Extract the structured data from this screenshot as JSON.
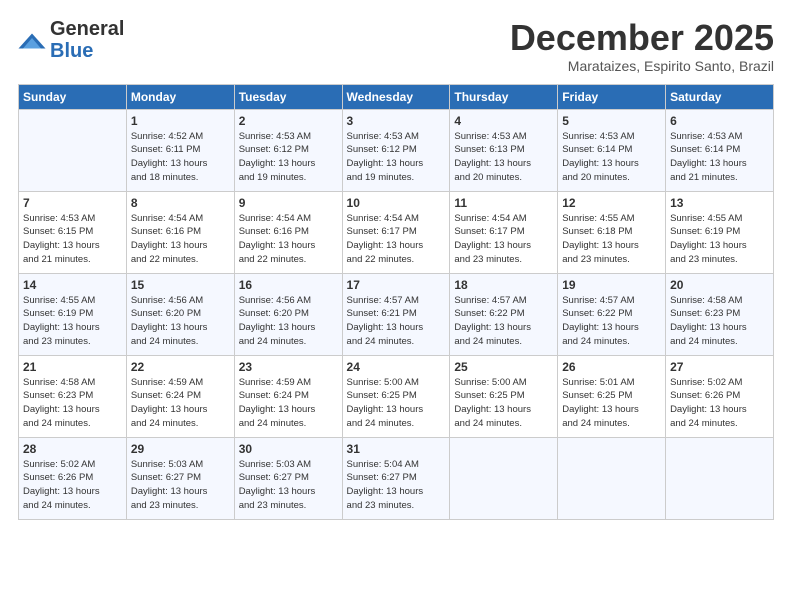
{
  "logo": {
    "line1": "General",
    "line2": "Blue"
  },
  "title": "December 2025",
  "subtitle": "Marataizes, Espirito Santo, Brazil",
  "header_days": [
    "Sunday",
    "Monday",
    "Tuesday",
    "Wednesday",
    "Thursday",
    "Friday",
    "Saturday"
  ],
  "weeks": [
    [
      {
        "day": "",
        "content": ""
      },
      {
        "day": "1",
        "content": "Sunrise: 4:52 AM\nSunset: 6:11 PM\nDaylight: 13 hours\nand 18 minutes."
      },
      {
        "day": "2",
        "content": "Sunrise: 4:53 AM\nSunset: 6:12 PM\nDaylight: 13 hours\nand 19 minutes."
      },
      {
        "day": "3",
        "content": "Sunrise: 4:53 AM\nSunset: 6:12 PM\nDaylight: 13 hours\nand 19 minutes."
      },
      {
        "day": "4",
        "content": "Sunrise: 4:53 AM\nSunset: 6:13 PM\nDaylight: 13 hours\nand 20 minutes."
      },
      {
        "day": "5",
        "content": "Sunrise: 4:53 AM\nSunset: 6:14 PM\nDaylight: 13 hours\nand 20 minutes."
      },
      {
        "day": "6",
        "content": "Sunrise: 4:53 AM\nSunset: 6:14 PM\nDaylight: 13 hours\nand 21 minutes."
      }
    ],
    [
      {
        "day": "7",
        "content": "Sunrise: 4:53 AM\nSunset: 6:15 PM\nDaylight: 13 hours\nand 21 minutes."
      },
      {
        "day": "8",
        "content": "Sunrise: 4:54 AM\nSunset: 6:16 PM\nDaylight: 13 hours\nand 22 minutes."
      },
      {
        "day": "9",
        "content": "Sunrise: 4:54 AM\nSunset: 6:16 PM\nDaylight: 13 hours\nand 22 minutes."
      },
      {
        "day": "10",
        "content": "Sunrise: 4:54 AM\nSunset: 6:17 PM\nDaylight: 13 hours\nand 22 minutes."
      },
      {
        "day": "11",
        "content": "Sunrise: 4:54 AM\nSunset: 6:17 PM\nDaylight: 13 hours\nand 23 minutes."
      },
      {
        "day": "12",
        "content": "Sunrise: 4:55 AM\nSunset: 6:18 PM\nDaylight: 13 hours\nand 23 minutes."
      },
      {
        "day": "13",
        "content": "Sunrise: 4:55 AM\nSunset: 6:19 PM\nDaylight: 13 hours\nand 23 minutes."
      }
    ],
    [
      {
        "day": "14",
        "content": "Sunrise: 4:55 AM\nSunset: 6:19 PM\nDaylight: 13 hours\nand 23 minutes."
      },
      {
        "day": "15",
        "content": "Sunrise: 4:56 AM\nSunset: 6:20 PM\nDaylight: 13 hours\nand 24 minutes."
      },
      {
        "day": "16",
        "content": "Sunrise: 4:56 AM\nSunset: 6:20 PM\nDaylight: 13 hours\nand 24 minutes."
      },
      {
        "day": "17",
        "content": "Sunrise: 4:57 AM\nSunset: 6:21 PM\nDaylight: 13 hours\nand 24 minutes."
      },
      {
        "day": "18",
        "content": "Sunrise: 4:57 AM\nSunset: 6:22 PM\nDaylight: 13 hours\nand 24 minutes."
      },
      {
        "day": "19",
        "content": "Sunrise: 4:57 AM\nSunset: 6:22 PM\nDaylight: 13 hours\nand 24 minutes."
      },
      {
        "day": "20",
        "content": "Sunrise: 4:58 AM\nSunset: 6:23 PM\nDaylight: 13 hours\nand 24 minutes."
      }
    ],
    [
      {
        "day": "21",
        "content": "Sunrise: 4:58 AM\nSunset: 6:23 PM\nDaylight: 13 hours\nand 24 minutes."
      },
      {
        "day": "22",
        "content": "Sunrise: 4:59 AM\nSunset: 6:24 PM\nDaylight: 13 hours\nand 24 minutes."
      },
      {
        "day": "23",
        "content": "Sunrise: 4:59 AM\nSunset: 6:24 PM\nDaylight: 13 hours\nand 24 minutes."
      },
      {
        "day": "24",
        "content": "Sunrise: 5:00 AM\nSunset: 6:25 PM\nDaylight: 13 hours\nand 24 minutes."
      },
      {
        "day": "25",
        "content": "Sunrise: 5:00 AM\nSunset: 6:25 PM\nDaylight: 13 hours\nand 24 minutes."
      },
      {
        "day": "26",
        "content": "Sunrise: 5:01 AM\nSunset: 6:25 PM\nDaylight: 13 hours\nand 24 minutes."
      },
      {
        "day": "27",
        "content": "Sunrise: 5:02 AM\nSunset: 6:26 PM\nDaylight: 13 hours\nand 24 minutes."
      }
    ],
    [
      {
        "day": "28",
        "content": "Sunrise: 5:02 AM\nSunset: 6:26 PM\nDaylight: 13 hours\nand 24 minutes."
      },
      {
        "day": "29",
        "content": "Sunrise: 5:03 AM\nSunset: 6:27 PM\nDaylight: 13 hours\nand 23 minutes."
      },
      {
        "day": "30",
        "content": "Sunrise: 5:03 AM\nSunset: 6:27 PM\nDaylight: 13 hours\nand 23 minutes."
      },
      {
        "day": "31",
        "content": "Sunrise: 5:04 AM\nSunset: 6:27 PM\nDaylight: 13 hours\nand 23 minutes."
      },
      {
        "day": "",
        "content": ""
      },
      {
        "day": "",
        "content": ""
      },
      {
        "day": "",
        "content": ""
      }
    ]
  ]
}
